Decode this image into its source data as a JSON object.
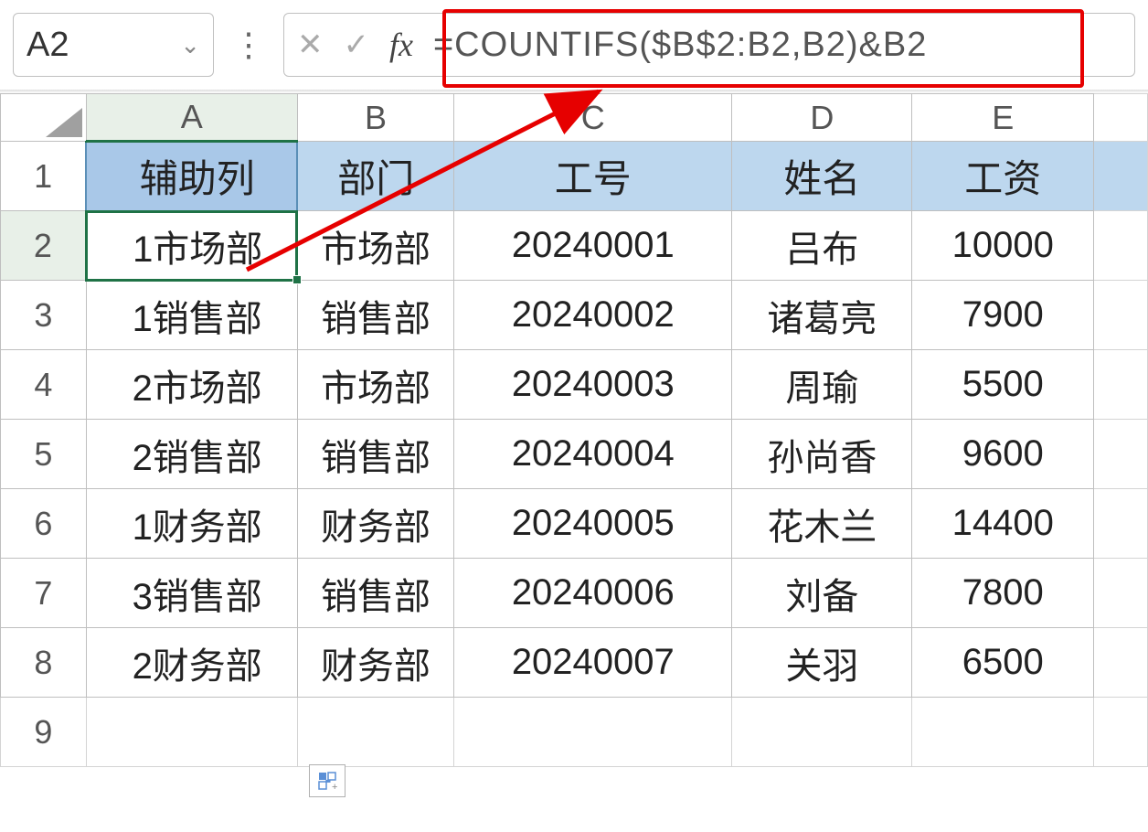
{
  "name_box": "A2",
  "formula": "=COUNTIFS($B$2:B2,B2)&B2",
  "columns": [
    "A",
    "B",
    "C",
    "D",
    "E"
  ],
  "headers": {
    "A": "辅助列",
    "B": "部门",
    "C": "工号",
    "D": "姓名",
    "E": "工资"
  },
  "rows": [
    {
      "n": "1"
    },
    {
      "n": "2",
      "A": "1市场部",
      "B": "市场部",
      "C": "20240001",
      "D": "吕布",
      "E": "10000"
    },
    {
      "n": "3",
      "A": "1销售部",
      "B": "销售部",
      "C": "20240002",
      "D": "诸葛亮",
      "E": "7900"
    },
    {
      "n": "4",
      "A": "2市场部",
      "B": "市场部",
      "C": "20240003",
      "D": "周瑜",
      "E": "5500"
    },
    {
      "n": "5",
      "A": "2销售部",
      "B": "销售部",
      "C": "20240004",
      "D": "孙尚香",
      "E": "9600"
    },
    {
      "n": "6",
      "A": "1财务部",
      "B": "财务部",
      "C": "20240005",
      "D": "花木兰",
      "E": "14400"
    },
    {
      "n": "7",
      "A": "3销售部",
      "B": "销售部",
      "C": "20240006",
      "D": "刘备",
      "E": "7800"
    },
    {
      "n": "8",
      "A": "2财务部",
      "B": "财务部",
      "C": "20240007",
      "D": "关羽",
      "E": "6500"
    },
    {
      "n": "9"
    }
  ],
  "icons": {
    "chevron": "⌄",
    "menu": "⋮",
    "cancel": "✕",
    "accept": "✓",
    "fx": "fx"
  }
}
